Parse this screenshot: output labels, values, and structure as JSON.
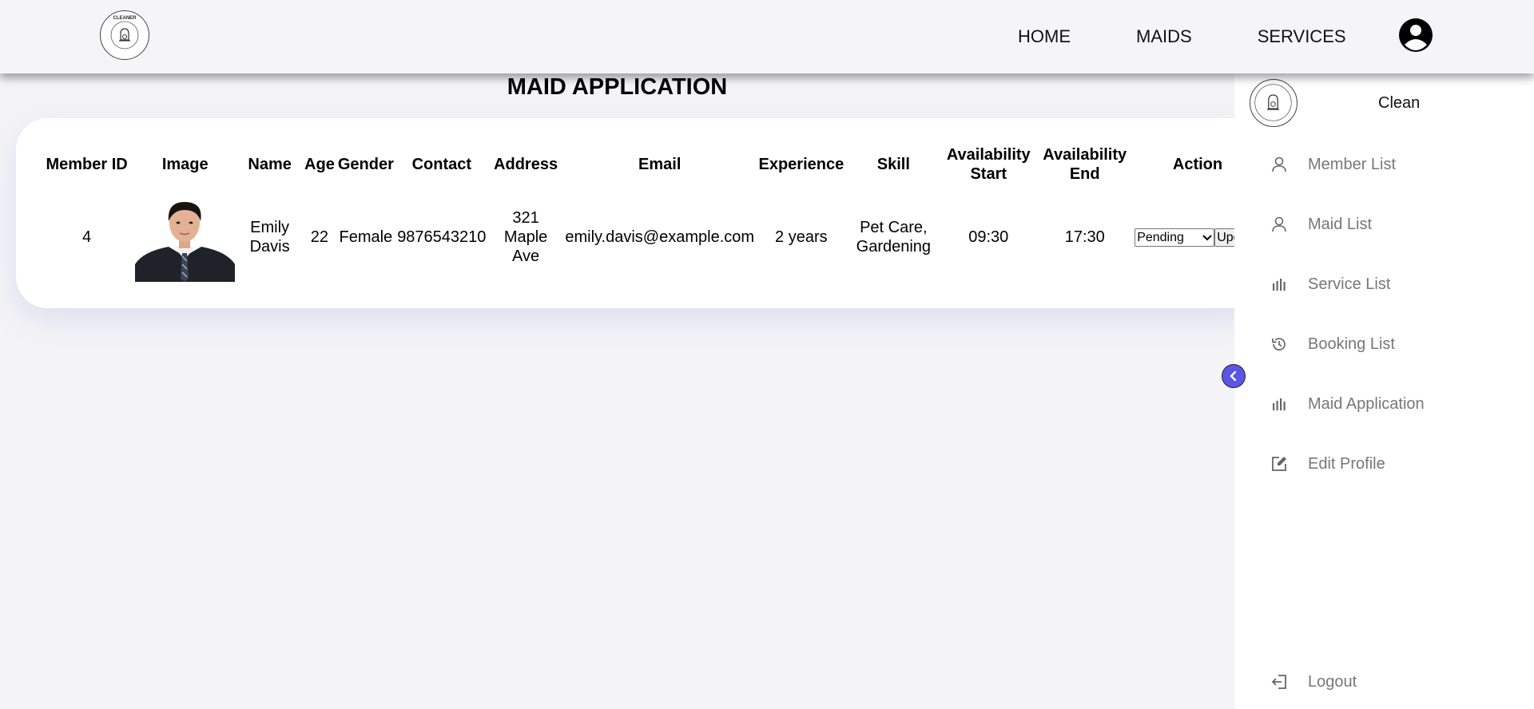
{
  "navbar": {
    "logo_text": "CLEANER",
    "links": [
      "HOME",
      "MAIDS",
      "SERVICES"
    ]
  },
  "page": {
    "title": "MAID APPLICATION"
  },
  "table": {
    "headers": [
      "Member ID",
      "Image",
      "Name",
      "Age",
      "Gender",
      "Contact",
      "Address",
      "Email",
      "Experience",
      "Skill",
      "Availability Start",
      "Availability End",
      "Action"
    ],
    "rows": [
      {
        "member_id": "4",
        "name": "Emily Davis",
        "age": "22",
        "gender": "Female",
        "contact": "9876543210",
        "address": "321 Maple Ave",
        "email": "emily.davis@example.com",
        "experience": "2 years",
        "skill": "Pet Care, Gardening",
        "availability_start": "09:30",
        "availability_end": "17:30",
        "status": "Pending",
        "update_label": "Update"
      }
    ]
  },
  "sidebar": {
    "brand": "Clean",
    "logo_text": "CLEANER",
    "items": [
      {
        "label": "Member List",
        "icon": "person-icon"
      },
      {
        "label": "Maid List",
        "icon": "person-icon"
      },
      {
        "label": "Service List",
        "icon": "bar-chart-icon"
      },
      {
        "label": "Booking List",
        "icon": "history-icon"
      },
      {
        "label": "Maid Application",
        "icon": "bar-chart-icon"
      },
      {
        "label": "Edit Profile",
        "icon": "edit-icon"
      }
    ],
    "logout": {
      "label": "Logout",
      "icon": "logout-icon"
    }
  },
  "colors": {
    "background": "#f4f4f7",
    "accent": "#5b55e6",
    "sidebar_text": "#777777"
  }
}
